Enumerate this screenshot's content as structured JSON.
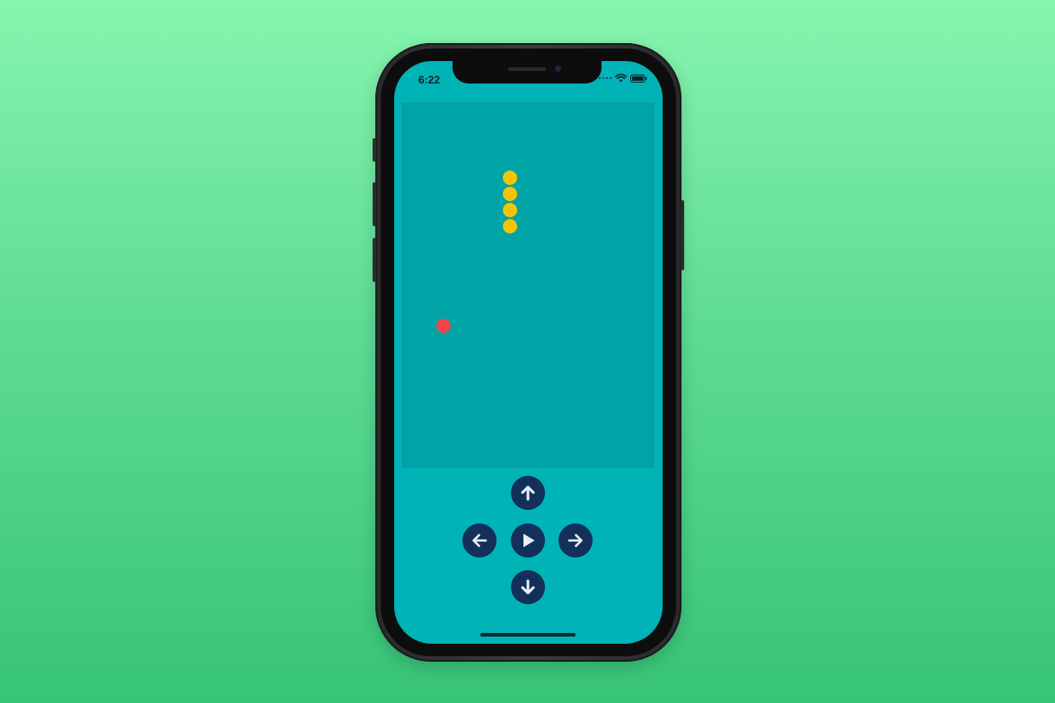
{
  "status_bar": {
    "time": "6:22",
    "icons": [
      "signal-dots-icon",
      "wifi-icon",
      "battery-icon"
    ]
  },
  "game": {
    "board_color": "#00a3a6",
    "snake_color": "#f5c400",
    "food_color": "#f0454c",
    "snake_segments": 4,
    "snake_direction": "vertical",
    "food_count": 1
  },
  "controls": {
    "up": "arrow-up-icon",
    "left": "arrow-left-icon",
    "play": "play-icon",
    "right": "arrow-right-icon",
    "down": "arrow-down-icon",
    "button_color": "#13305a"
  },
  "colors": {
    "background": "#5fdc96",
    "screen": "#00b3b7"
  }
}
